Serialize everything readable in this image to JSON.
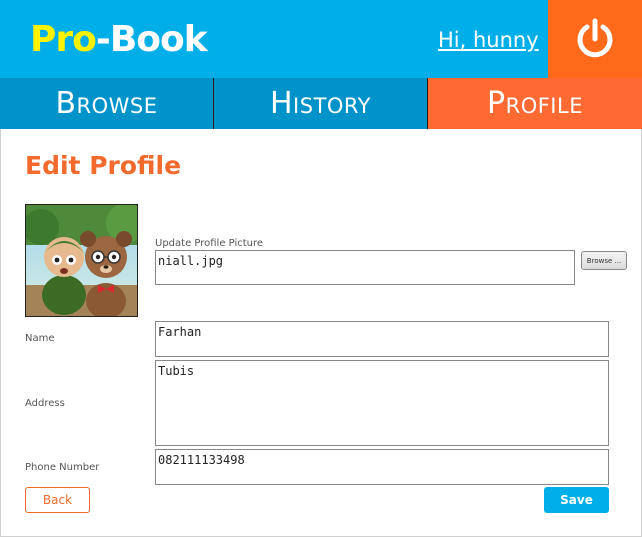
{
  "header": {
    "logo_part1": "Pro",
    "logo_part2": "-Book",
    "greeting": "Hi, hunny",
    "power_icon": "power-icon"
  },
  "nav": {
    "items": [
      {
        "label": "Browse"
      },
      {
        "label": "History"
      },
      {
        "label": "Profile"
      }
    ],
    "active": "Profile"
  },
  "page": {
    "title": "Edit Profile"
  },
  "form": {
    "update_picture_label": "Update Profile Picture",
    "file_value": "niall.jpg",
    "browse_label": "Browse ...",
    "name_label": "Name",
    "name_value": "Farhan",
    "address_label": "Address",
    "address_value": "Tubis",
    "phone_label": "Phone Number",
    "phone_value": "082111133498",
    "back_label": "Back",
    "save_label": "Save"
  },
  "colors": {
    "header_blue": "#00aee8",
    "nav_blue": "#0093c9",
    "accent_orange": "#ff6a1a",
    "title_orange": "#f26a2c",
    "logo_yellow": "#fff200"
  }
}
